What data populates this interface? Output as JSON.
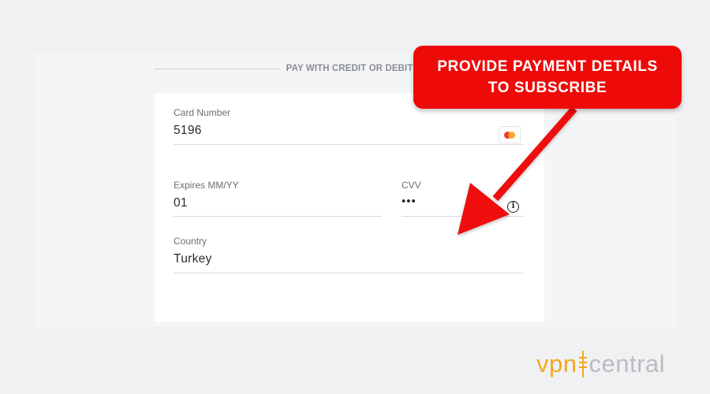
{
  "payment": {
    "section_title": "PAY WITH CREDIT OR DEBIT",
    "card_number": {
      "label": "Card Number",
      "value": "5196",
      "brand_icon": "mastercard-icon"
    },
    "expires": {
      "label": "Expires MM/YY",
      "value": "01"
    },
    "cvv": {
      "label": "CVV",
      "value": "•••",
      "help_icon": "info-icon"
    },
    "country": {
      "label": "Country",
      "value": "Turkey"
    }
  },
  "callout": {
    "line1": "PROVIDE PAYMENT DETAILS",
    "line2": "TO SUBSCRIBE",
    "color": "#ef0a0a"
  },
  "watermark": {
    "part1": "vpn",
    "part2": "central",
    "accent": "#f5a81c",
    "gray": "#b9bcc0"
  }
}
